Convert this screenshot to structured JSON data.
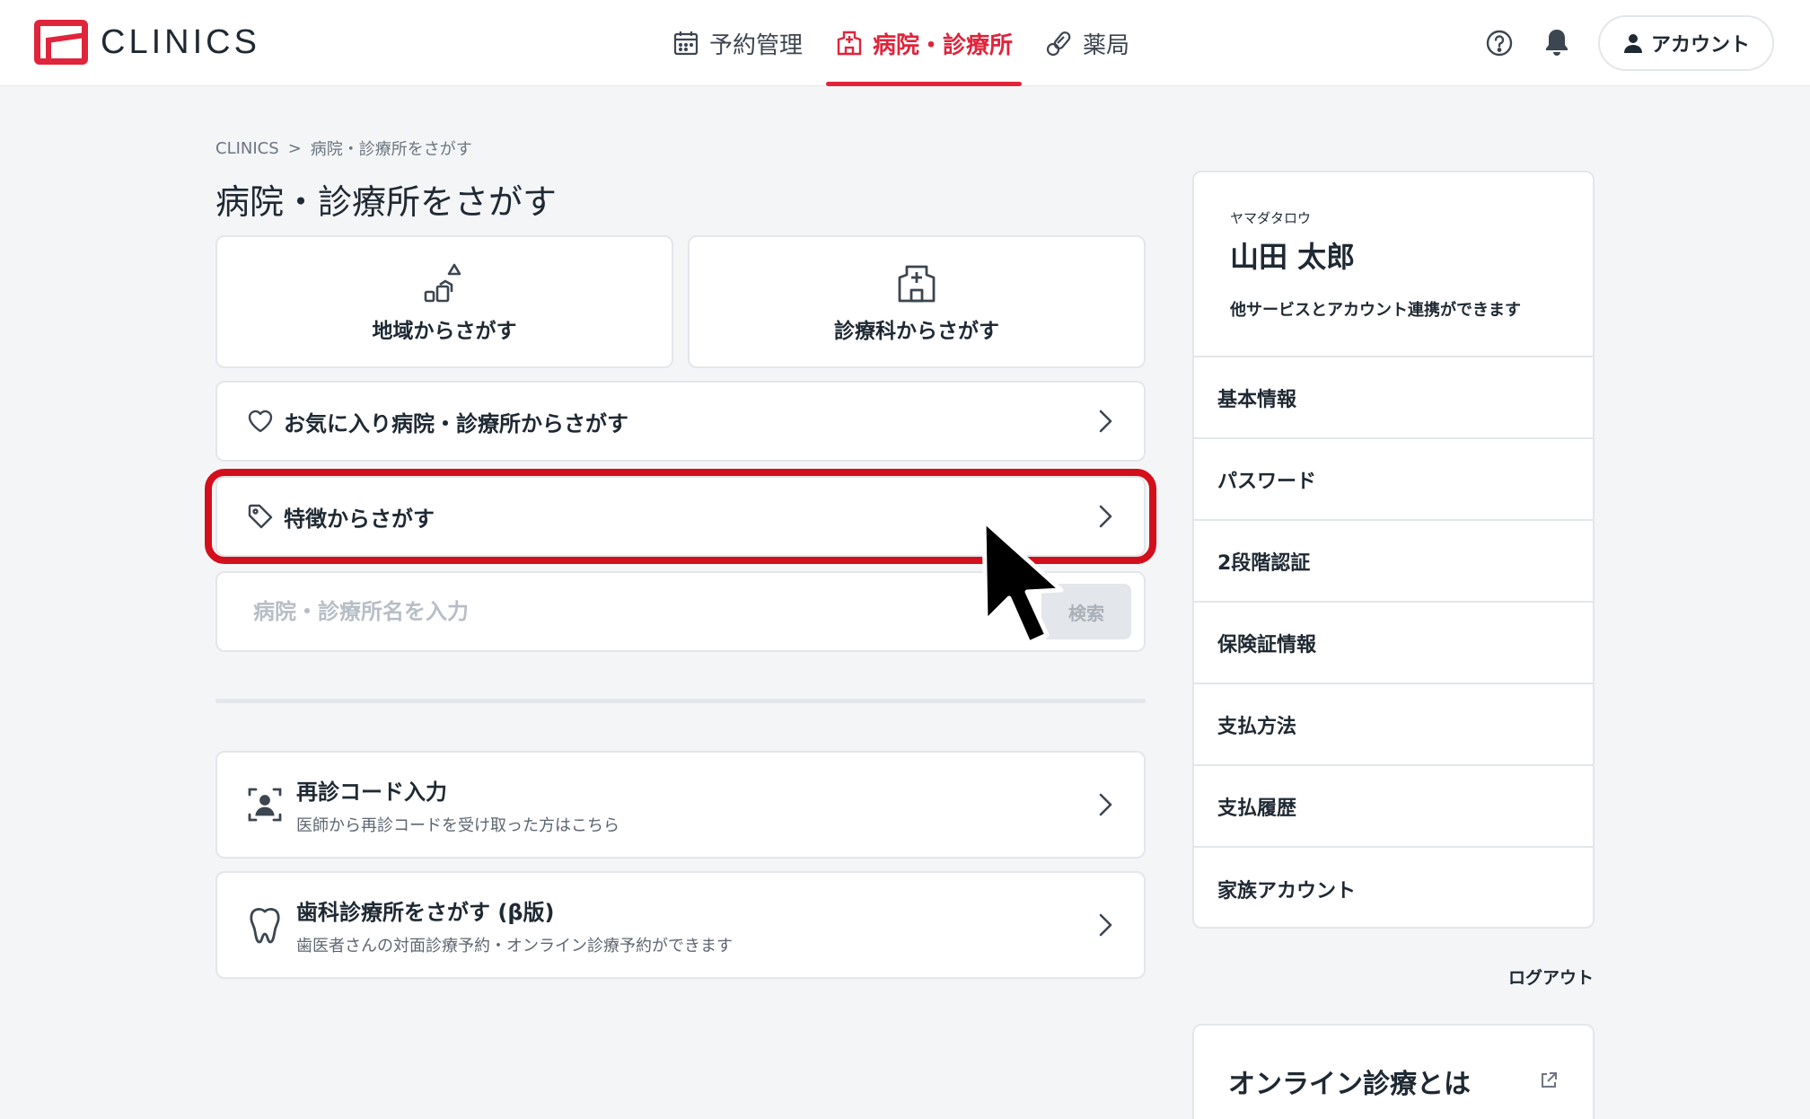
{
  "app": {
    "logo_text": "CLINICS",
    "brand_color": "#e0243b"
  },
  "nav": {
    "items": [
      {
        "label": "予約管理",
        "icon": "calendar-icon"
      },
      {
        "label": "病院・診療所",
        "icon": "hospital-icon",
        "active": true
      },
      {
        "label": "薬局",
        "icon": "pill-icon"
      }
    ]
  },
  "header": {
    "account_label": "アカウント"
  },
  "breadcrumb": {
    "home": "CLINICS",
    "separator": ">",
    "current": "病院・診療所をさがす"
  },
  "main": {
    "title": "病院・診療所をさがす",
    "search_by_area": "地域からさがす",
    "search_by_department": "診療科からさがす",
    "favorites_label": "お気に入り病院・診療所からさがす",
    "features_label": "特徴からさがす",
    "search": {
      "placeholder": "病院・診療所名を入力",
      "button": "検索"
    },
    "revisit": {
      "title": "再診コード入力",
      "subtitle": "医師から再診コードを受け取った方はこちら"
    },
    "dental": {
      "title": "歯科診療所をさがす (β版)",
      "subtitle": "歯医者さんの対面診療予約・オンライン診療予約ができます"
    }
  },
  "sidebar": {
    "kana": "ヤマダタロウ",
    "name": "山田 太郎",
    "link_note": "他サービスとアカウント連携ができます",
    "items": [
      {
        "label": "基本情報"
      },
      {
        "label": "パスワード"
      },
      {
        "label": "2段階認証"
      },
      {
        "label": "保険証情報"
      },
      {
        "label": "支払方法"
      },
      {
        "label": "支払履歴"
      },
      {
        "label": "家族アカウント"
      }
    ],
    "logout": "ログアウト",
    "online_title": "オンライン診療とは"
  },
  "colors": {
    "highlight": "#d40f1c",
    "accent": "#e0243b"
  }
}
